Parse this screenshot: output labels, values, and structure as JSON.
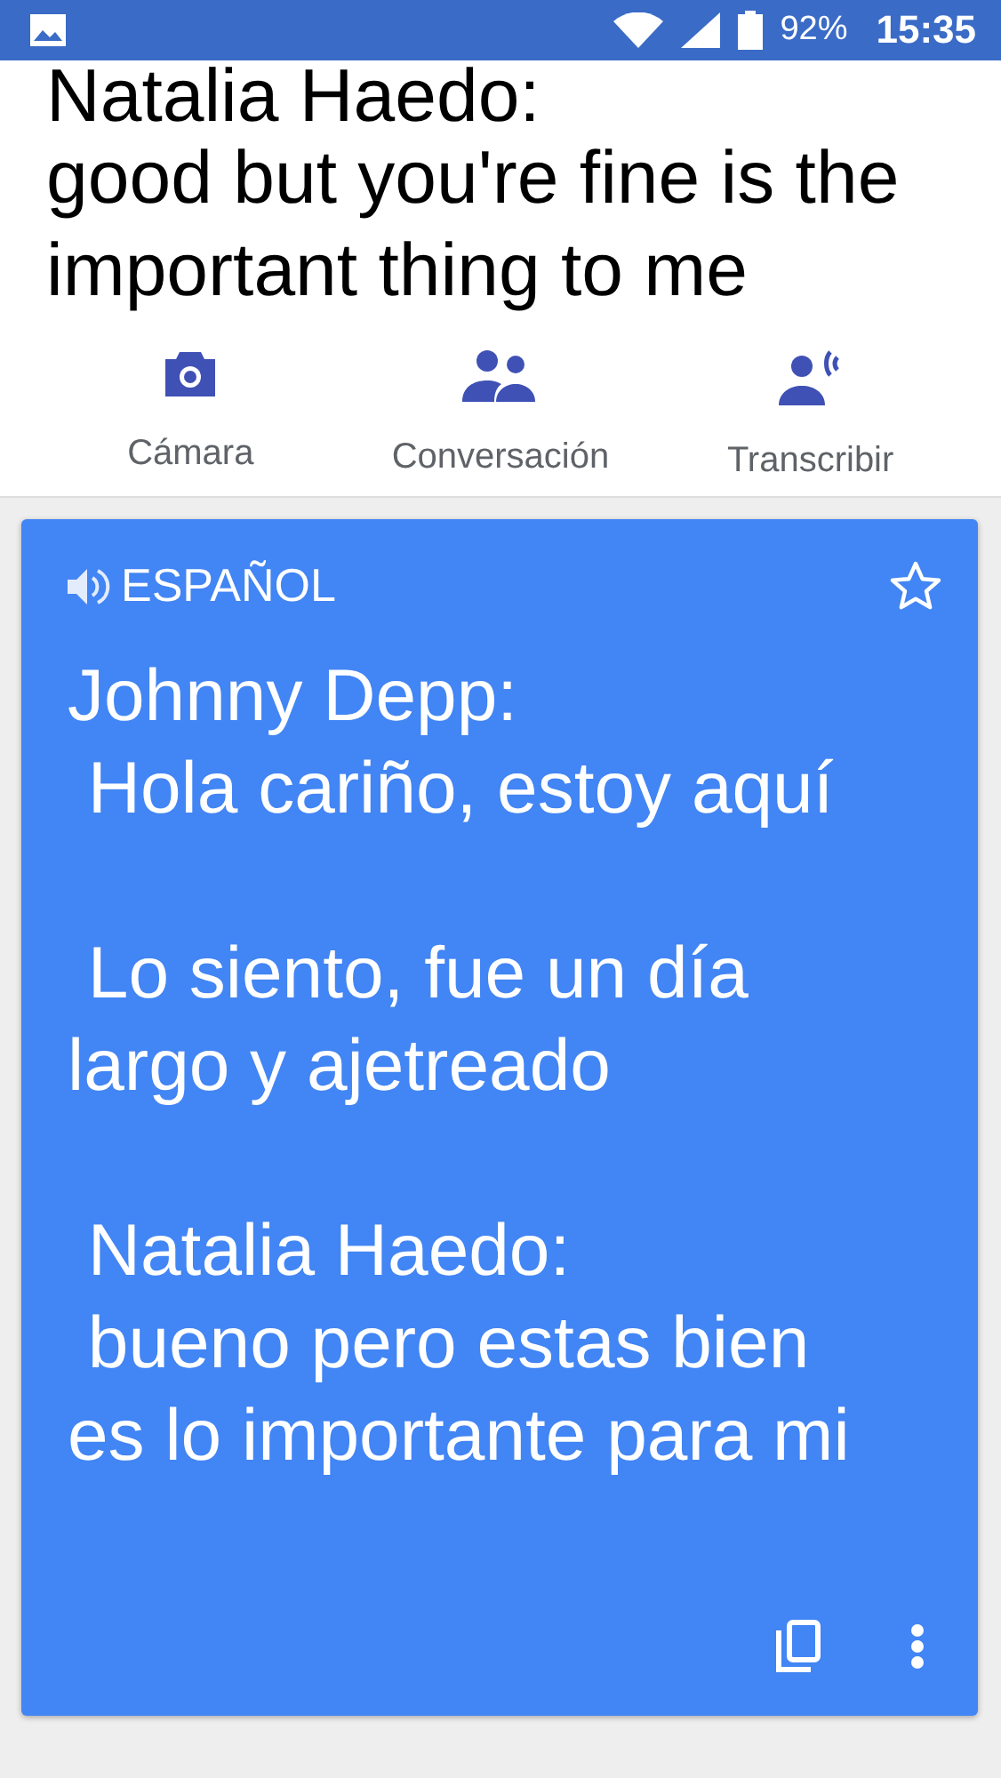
{
  "status_bar": {
    "battery": "92%",
    "time": "15:35"
  },
  "source_text": [
    "Natalia Haedo:",
    "good but you're fine is the",
    "important thing to me"
  ],
  "actions": [
    {
      "kind": "camera",
      "label": "Cámara"
    },
    {
      "kind": "conversation",
      "label": "Conversación"
    },
    {
      "kind": "transcribe",
      "label": "Transcribir"
    }
  ],
  "translation": {
    "language": "ESPAÑOL",
    "starred": false,
    "paragraphs": [
      [
        "Johnny Depp:",
        " Hola cariño, estoy aquí"
      ],
      [
        " Lo siento, fue un día",
        "largo y ajetreado"
      ],
      [
        " Natalia Haedo:",
        " bueno pero estas bien",
        "es lo importante para mi"
      ]
    ]
  }
}
